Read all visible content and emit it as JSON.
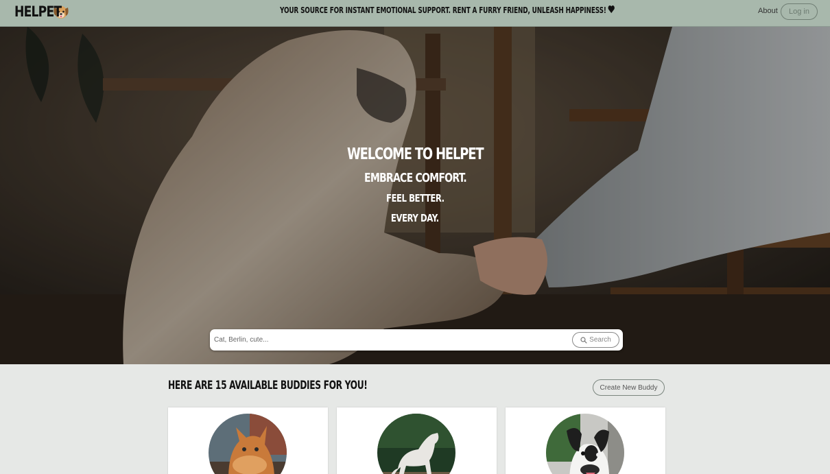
{
  "navbar": {
    "brand": "HELPET",
    "tagline": "YOUR SOURCE FOR INSTANT EMOTIONAL SUPPORT. RENT A FURRY FRIEND, UNLEASH HAPPINESS!",
    "about": "About",
    "login": "Log in"
  },
  "hero": {
    "title": "WELCOME TO HELPET",
    "line1": "EMBRACE COMFORT.",
    "line2": "FEEL BETTER.",
    "line3": "EVERY DAY.",
    "search": {
      "placeholder": "Cat, Berlin, cute...",
      "button": "Search"
    }
  },
  "listing": {
    "heading": "HERE ARE 15 AVAILABLE BUDDIES FOR YOU!",
    "create_button": "Create New Buddy",
    "cards": [
      {
        "image": "orange-cat-photo"
      },
      {
        "image": "white-horse-photo"
      },
      {
        "image": "black-white-dog-photo"
      }
    ]
  },
  "colors": {
    "navbar_bg": "#a8b8ac",
    "page_bg": "#e6e8e6"
  }
}
